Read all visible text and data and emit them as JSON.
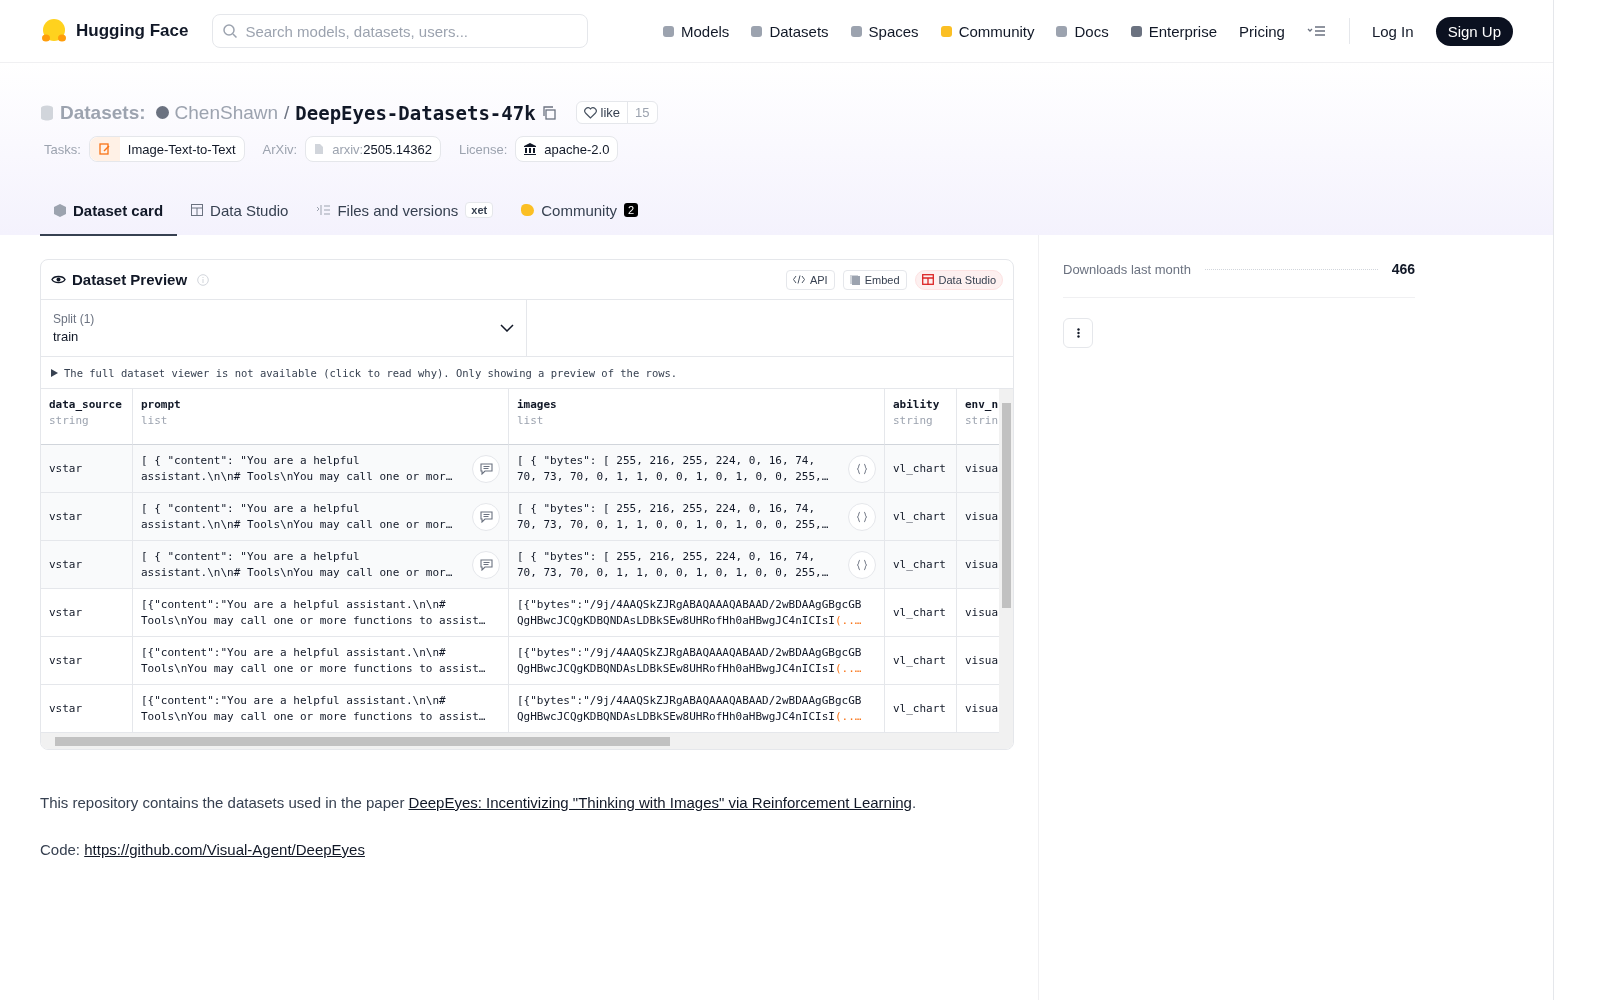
{
  "nav": {
    "brand": "Hugging Face",
    "search_placeholder": "Search models, datasets, users...",
    "items": [
      {
        "label": "Models"
      },
      {
        "label": "Datasets"
      },
      {
        "label": "Spaces"
      },
      {
        "label": "Community"
      },
      {
        "label": "Docs"
      },
      {
        "label": "Enterprise"
      },
      {
        "label": "Pricing"
      }
    ],
    "login": "Log In",
    "signup": "Sign Up"
  },
  "header": {
    "section": "Datasets:",
    "owner": "ChenShawn",
    "separator": "/",
    "name": "DeepEyes-Datasets-47k",
    "like": "like",
    "likes": "15",
    "meta": [
      {
        "label": "Tasks:",
        "value": "Image-Text-to-Text"
      },
      {
        "label": "ArXiv:",
        "prefix": "arxiv:",
        "value": "2505.14362"
      },
      {
        "label": "License:",
        "value": "apache-2.0"
      }
    ]
  },
  "tabs": [
    {
      "label": "Dataset card",
      "selected": true
    },
    {
      "label": "Data Studio",
      "selected": false
    },
    {
      "label": "Files and versions",
      "badge": "xet",
      "selected": false
    },
    {
      "label": "Community",
      "count": "2",
      "selected": false
    }
  ],
  "preview": {
    "title": "Dataset Preview",
    "actions": [
      "API",
      "Embed",
      "Data Studio"
    ],
    "split_label": "Split (1)",
    "split_value": "train",
    "notice": "The full dataset viewer is not available (click to read why). Only showing a preview of the rows.",
    "columns": [
      {
        "name": "data_source",
        "type": "string"
      },
      {
        "name": "prompt",
        "type": "list"
      },
      {
        "name": "images",
        "type": "list"
      },
      {
        "name": "ability",
        "type": "string"
      },
      {
        "name": "env_n",
        "type": "strin"
      }
    ],
    "rows": [
      {
        "kind": "json",
        "data_source": "vstar",
        "prompt": [
          "[ { \"content\": \"You are a helpful",
          "assistant.\\n\\n# Tools\\nYou may call one or mor…"
        ],
        "images": [
          "[ { \"bytes\": [ 255, 216, 255, 224, 0, 16, 74,",
          "70, 73, 70, 0, 1, 1, 0, 0, 1, 0, 1, 0, 0, 255,…"
        ],
        "ability": "vl_chart",
        "env": "visua"
      },
      {
        "kind": "json",
        "data_source": "vstar",
        "prompt": [
          "[ { \"content\": \"You are a helpful",
          "assistant.\\n\\n# Tools\\nYou may call one or mor…"
        ],
        "images": [
          "[ { \"bytes\": [ 255, 216, 255, 224, 0, 16, 74,",
          "70, 73, 70, 0, 1, 1, 0, 0, 1, 0, 1, 0, 0, 255,…"
        ],
        "ability": "vl_chart",
        "env": "visua"
      },
      {
        "kind": "json",
        "data_source": "vstar",
        "prompt": [
          "[ { \"content\": \"You are a helpful",
          "assistant.\\n\\n# Tools\\nYou may call one or mor…"
        ],
        "images": [
          "[ { \"bytes\": [ 255, 216, 255, 224, 0, 16, 74,",
          "70, 73, 70, 0, 1, 1, 0, 0, 1, 0, 1, 0, 0, 255,…"
        ],
        "ability": "vl_chart",
        "env": "visua"
      },
      {
        "kind": "text",
        "data_source": "vstar",
        "prompt": [
          "[{\"content\":\"You are a helpful assistant.\\n\\n#",
          "Tools\\nYou may call one or more functions to assist…"
        ],
        "images": [
          "[{\"bytes\":\"/9j/4AAQSkZJRgABAQAAAQABAAD/2wBDAAgGBgcGB",
          "QgHBwcJCQgKDBQNDAsLDBkSEw8UHRofHh0aHBwgJC4nICIsI"
        ],
        "images_more": "(..…",
        "ability": "vl_chart",
        "env": "visua"
      },
      {
        "kind": "text",
        "data_source": "vstar",
        "prompt": [
          "[{\"content\":\"You are a helpful assistant.\\n\\n#",
          "Tools\\nYou may call one or more functions to assist…"
        ],
        "images": [
          "[{\"bytes\":\"/9j/4AAQSkZJRgABAQAAAQABAAD/2wBDAAgGBgcGB",
          "QgHBwcJCQgKDBQNDAsLDBkSEw8UHRofHh0aHBwgJC4nICIsI"
        ],
        "images_more": "(..…",
        "ability": "vl_chart",
        "env": "visua"
      },
      {
        "kind": "text",
        "data_source": "vstar",
        "prompt": [
          "[{\"content\":\"You are a helpful assistant.\\n\\n#",
          "Tools\\nYou may call one or more functions to assist…"
        ],
        "images": [
          "[{\"bytes\":\"/9j/4AAQSkZJRgABAQAAAQABAAD/2wBDAAgGBgcGB",
          "QgHBwcJCQgKDBQNDAsLDBkSEw8UHRofHh0aHBwgJC4nICIsI"
        ],
        "images_more": "(..…",
        "ability": "vl_chart",
        "env": "visua"
      }
    ]
  },
  "body": {
    "paper_text": "This repository contains the datasets used in the paper ",
    "paper_link": "DeepEyes: Incentivizing \"Thinking with Images\" via Reinforcement Learning",
    "paper_after": ".",
    "code_label": "Code: ",
    "code_link": "https://github.com/Visual-Agent/DeepEyes"
  },
  "sidebar": {
    "downloads_label": "Downloads last month",
    "downloads": "466"
  }
}
